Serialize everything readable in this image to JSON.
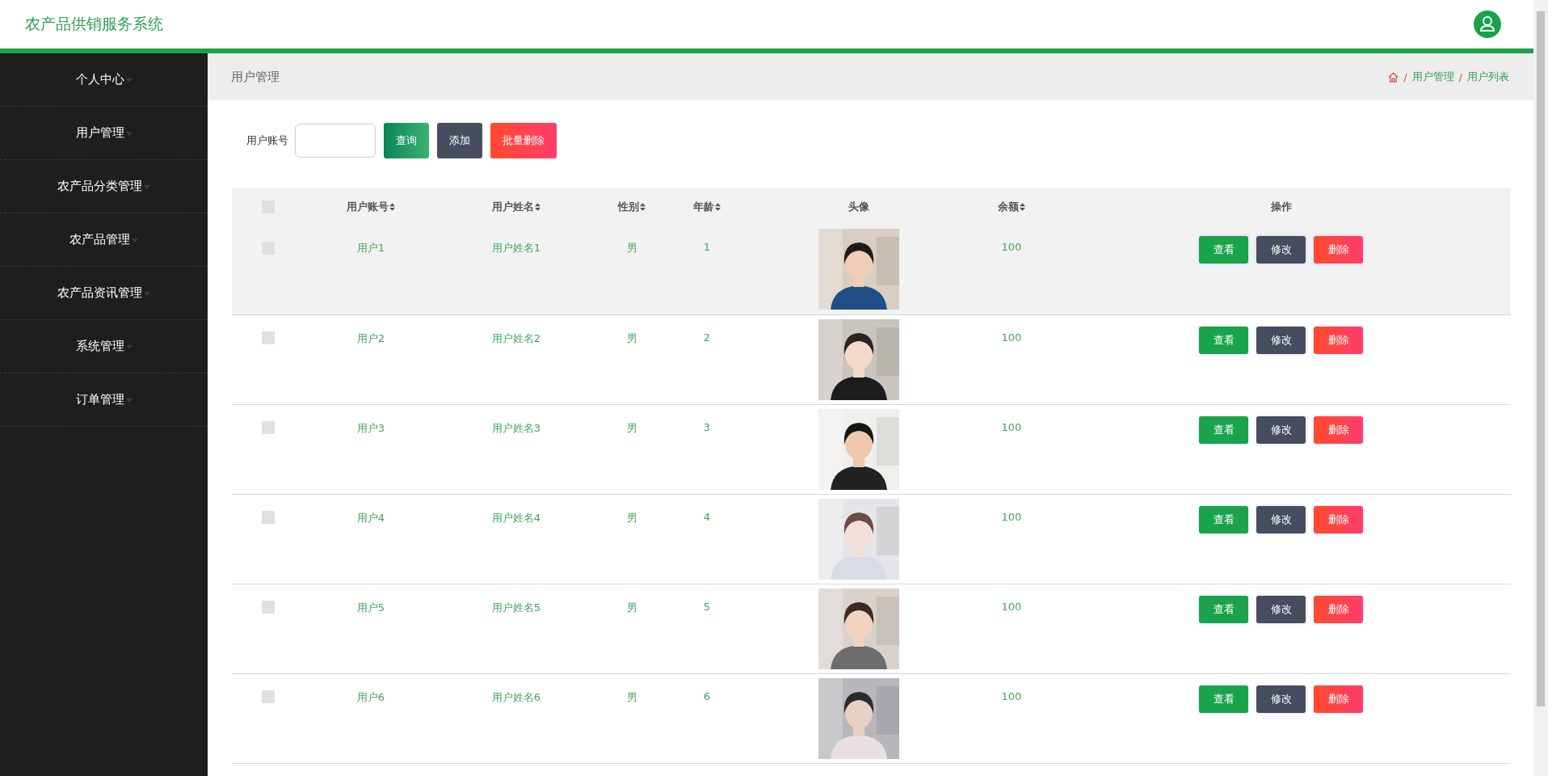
{
  "header": {
    "title": "农产品供销服务系统"
  },
  "sidebar": {
    "items": [
      {
        "label": "个人中心"
      },
      {
        "label": "用户管理"
      },
      {
        "label": "农产品分类管理"
      },
      {
        "label": "农产品管理"
      },
      {
        "label": "农产品资讯管理"
      },
      {
        "label": "系统管理"
      },
      {
        "label": "订单管理"
      }
    ]
  },
  "page_bar": {
    "title": "用户管理",
    "breadcrumb": [
      {
        "separator": "/",
        "label": "用户管理"
      },
      {
        "separator": "/",
        "label": "用户列表"
      }
    ]
  },
  "search": {
    "label": "用户账号",
    "buttons": [
      {
        "label": "查询",
        "kind": "search"
      },
      {
        "label": "添加",
        "kind": "add"
      },
      {
        "label": "批量删除",
        "kind": "delete"
      }
    ]
  },
  "table": {
    "select_all_checked": false,
    "columns": [
      {
        "label": "用户账号",
        "sortable": true
      },
      {
        "label": "用户姓名",
        "sortable": true
      },
      {
        "label": "性别",
        "sortable": true
      },
      {
        "label": "年龄",
        "sortable": true
      },
      {
        "label": "头像",
        "sortable": false
      },
      {
        "label": "余额",
        "sortable": true
      },
      {
        "label": "操作",
        "sortable": false
      }
    ],
    "rows": [
      {
        "account": "用户1",
        "name": "用户姓名1",
        "gender": "男",
        "age": "1",
        "balance": "100",
        "highlighted": true,
        "checked": false,
        "actions": [
          {
            "label": "查看",
            "kind": "view"
          },
          {
            "label": "修改",
            "kind": "edit"
          },
          {
            "label": "删除",
            "kind": "delete"
          }
        ]
      },
      {
        "account": "用户2",
        "name": "用户姓名2",
        "gender": "男",
        "age": "2",
        "balance": "100",
        "highlighted": false,
        "checked": false,
        "actions": [
          {
            "label": "查看",
            "kind": "view"
          },
          {
            "label": "修改",
            "kind": "edit"
          },
          {
            "label": "删除",
            "kind": "delete"
          }
        ]
      },
      {
        "account": "用户3",
        "name": "用户姓名3",
        "gender": "男",
        "age": "3",
        "balance": "100",
        "highlighted": false,
        "checked": false,
        "actions": [
          {
            "label": "查看",
            "kind": "view"
          },
          {
            "label": "修改",
            "kind": "edit"
          },
          {
            "label": "删除",
            "kind": "delete"
          }
        ]
      },
      {
        "account": "用户4",
        "name": "用户姓名4",
        "gender": "男",
        "age": "4",
        "balance": "100",
        "highlighted": false,
        "checked": false,
        "actions": [
          {
            "label": "查看",
            "kind": "view"
          },
          {
            "label": "修改",
            "kind": "edit"
          },
          {
            "label": "删除",
            "kind": "delete"
          }
        ]
      },
      {
        "account": "用户5",
        "name": "用户姓名5",
        "gender": "男",
        "age": "5",
        "balance": "100",
        "highlighted": false,
        "checked": false,
        "actions": [
          {
            "label": "查看",
            "kind": "view"
          },
          {
            "label": "修改",
            "kind": "edit"
          },
          {
            "label": "删除",
            "kind": "delete"
          }
        ]
      },
      {
        "account": "用户6",
        "name": "用户姓名6",
        "gender": "男",
        "age": "6",
        "balance": "100",
        "highlighted": false,
        "checked": false,
        "actions": [
          {
            "label": "查看",
            "kind": "view"
          },
          {
            "label": "修改",
            "kind": "edit"
          },
          {
            "label": "删除",
            "kind": "delete"
          }
        ]
      }
    ]
  }
}
